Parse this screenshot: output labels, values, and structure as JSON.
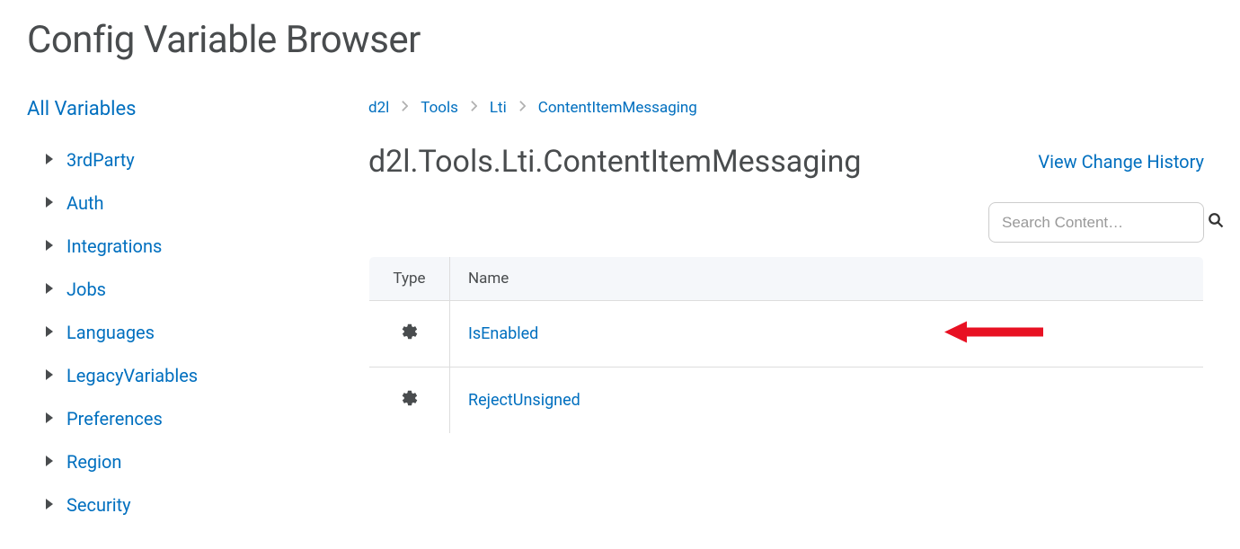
{
  "page_title": "Config Variable Browser",
  "sidebar": {
    "heading": "All Variables",
    "items": [
      {
        "label": "3rdParty"
      },
      {
        "label": "Auth"
      },
      {
        "label": "Integrations"
      },
      {
        "label": "Jobs"
      },
      {
        "label": "Languages"
      },
      {
        "label": "LegacyVariables"
      },
      {
        "label": "Preferences"
      },
      {
        "label": "Region"
      },
      {
        "label": "Security"
      }
    ]
  },
  "breadcrumb": [
    "d2l",
    "Tools",
    "Lti",
    "ContentItemMessaging"
  ],
  "section_heading": "d2l.Tools.Lti.ContentItemMessaging",
  "change_history_label": "View Change History",
  "search": {
    "placeholder": "Search Content…"
  },
  "table": {
    "columns": [
      "Type",
      "Name"
    ],
    "rows": [
      {
        "name": "IsEnabled",
        "highlighted": true
      },
      {
        "name": "RejectUnsigned",
        "highlighted": false
      }
    ]
  }
}
